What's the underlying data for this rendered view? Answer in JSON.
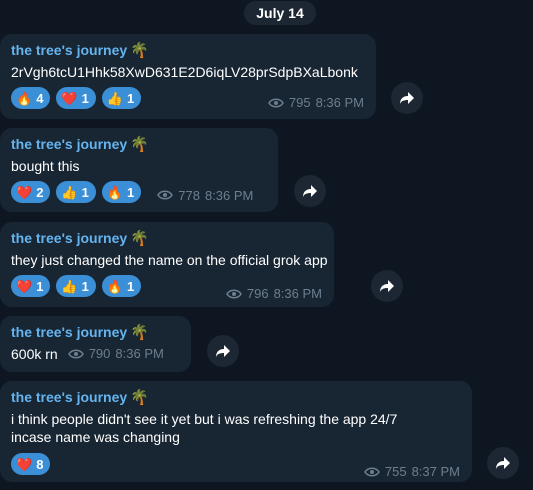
{
  "date_separator": "July 14",
  "messages": [
    {
      "sender": "the tree's journey",
      "sender_emoji": "🌴",
      "text": "2rVgh6tcU1Hhk58XwD631E2D6iqLV28prSdpBXaLbonk",
      "reactions": [
        {
          "emoji": "🔥",
          "count": "4"
        },
        {
          "emoji": "❤️",
          "count": "1"
        },
        {
          "emoji": "👍",
          "count": "1"
        }
      ],
      "views": "795",
      "time": "8:36 PM"
    },
    {
      "sender": "the tree's journey",
      "sender_emoji": "🌴",
      "text": "bought this",
      "reactions": [
        {
          "emoji": "❤️",
          "count": "2"
        },
        {
          "emoji": "👍",
          "count": "1"
        },
        {
          "emoji": "🔥",
          "count": "1"
        }
      ],
      "views": "778",
      "time": "8:36 PM"
    },
    {
      "sender": "the tree's journey",
      "sender_emoji": "🌴",
      "text": "they just changed the name on the official grok app",
      "reactions": [
        {
          "emoji": "❤️",
          "count": "1"
        },
        {
          "emoji": "👍",
          "count": "1"
        },
        {
          "emoji": "🔥",
          "count": "1"
        }
      ],
      "views": "796",
      "time": "8:36 PM"
    },
    {
      "sender": "the tree's journey",
      "sender_emoji": "🌴",
      "text": "600k rn",
      "reactions": [],
      "views": "790",
      "time": "8:36 PM"
    },
    {
      "sender": "the tree's journey",
      "sender_emoji": "🌴",
      "text_lines": [
        "i think people didn't see it yet but i was refreshing the app 24/7",
        "incase name was changing"
      ],
      "reactions": [
        {
          "emoji": "❤️",
          "count": "8"
        }
      ],
      "views": "755",
      "time": "8:37 PM"
    }
  ],
  "icons": {
    "views": "eye-icon",
    "forward": "forward-arrow-icon"
  },
  "colors": {
    "background": "#0e1621",
    "bubble": "#182533",
    "sender_name": "#64b5ef",
    "reaction_pill": "#3a8fd6",
    "meta_text": "#6d7f8f"
  }
}
